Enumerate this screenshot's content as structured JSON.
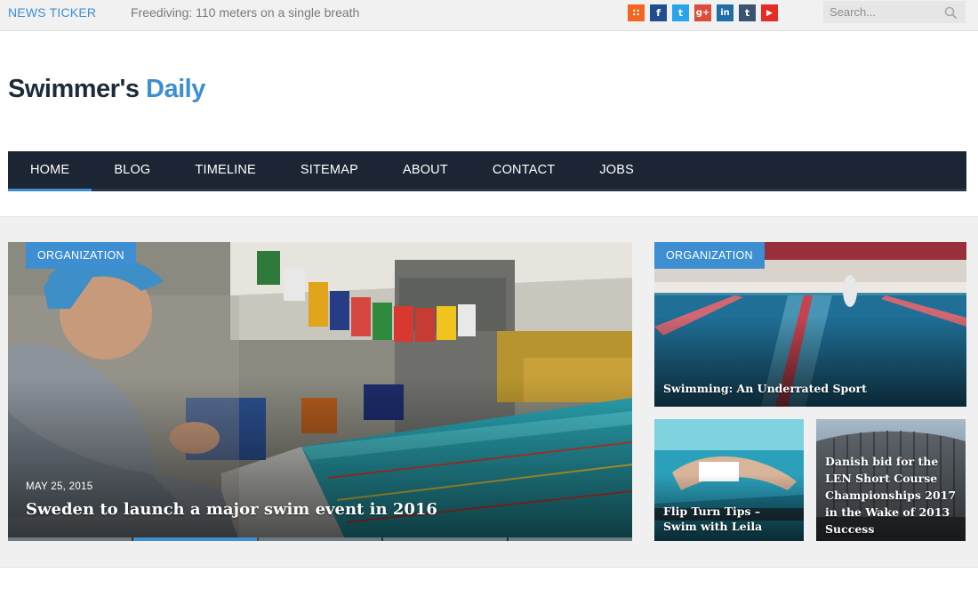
{
  "ticker": {
    "label": "NEWS TICKER",
    "headline": "Freediving: 110 meters on a single breath"
  },
  "social": [
    {
      "name": "rss",
      "glyph": "∷",
      "color": "#f26522"
    },
    {
      "name": "facebook",
      "glyph": "f",
      "color": "#1f4d8f"
    },
    {
      "name": "twitter",
      "glyph": "t",
      "color": "#2aa3ef"
    },
    {
      "name": "google-plus",
      "glyph": "g+",
      "color": "#dd4b39"
    },
    {
      "name": "linkedin",
      "glyph": "in",
      "color": "#1f6ea8"
    },
    {
      "name": "tumblr",
      "glyph": "t",
      "color": "#3a5370"
    },
    {
      "name": "youtube",
      "glyph": "▶",
      "color": "#e52d27"
    }
  ],
  "search": {
    "placeholder": "Search..."
  },
  "logo": {
    "part1": "Swimmer's ",
    "part2": "Daily"
  },
  "nav": [
    "HOME",
    "BLOG",
    "TIMELINE",
    "SITEMAP",
    "ABOUT",
    "CONTACT",
    "JOBS"
  ],
  "featured": {
    "category": "ORGANIZATION",
    "date": "MAY 25, 2015",
    "title": "Sweden to launch a major swim event in 2016"
  },
  "side": [
    {
      "category": "ORGANIZATION",
      "title": "Swimming: An Underrated Sport"
    },
    {
      "title": "Flip Turn Tips – Swim with Leila"
    },
    {
      "title": "Danish bid for the LEN Short Course Championships 2017 in the Wake of 2013 Success"
    }
  ],
  "colors": {
    "accent": "#3e8fd1",
    "nav_bg": "#1b2533",
    "band_bg": "#f0f0f0"
  }
}
